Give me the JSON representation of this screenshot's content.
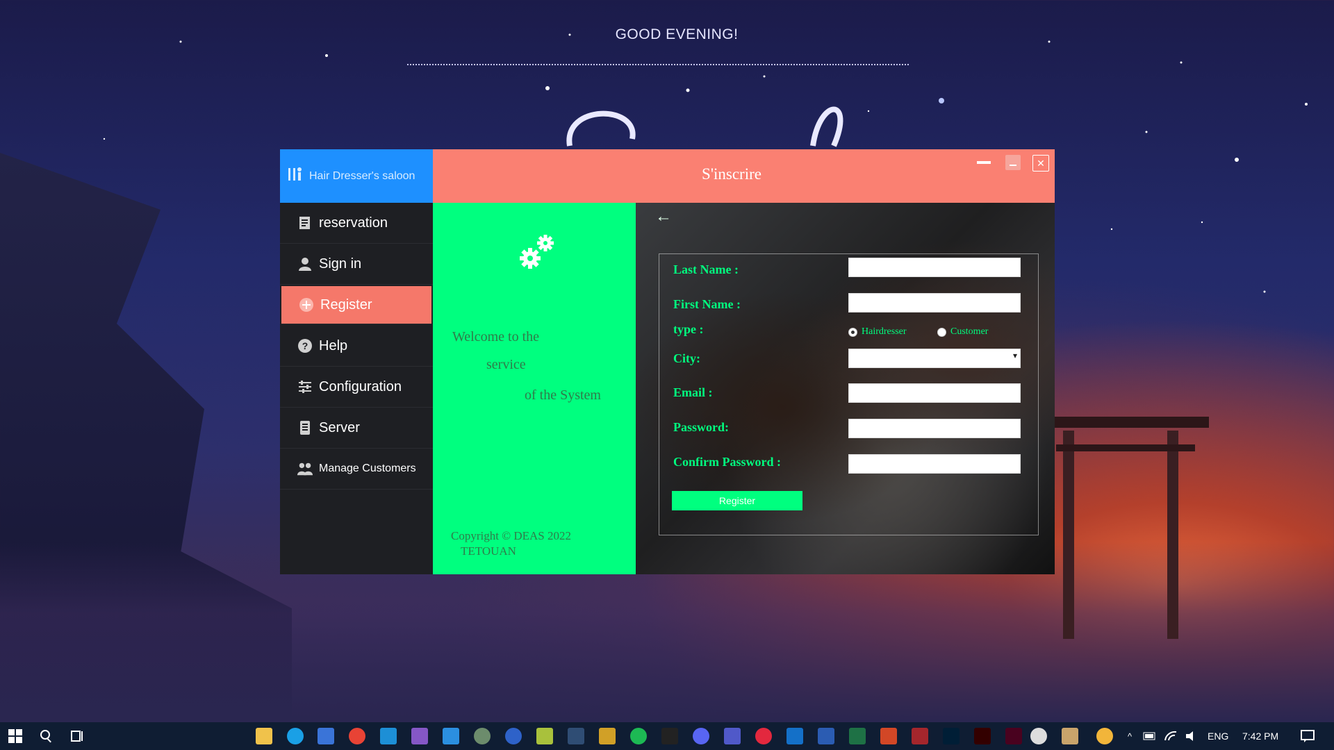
{
  "desktop": {
    "greeting": "GOOD EVENING!"
  },
  "sidebar": {
    "brand": "Hair Dresser's saloon",
    "items": [
      {
        "label": "reservation",
        "icon": "reservation-icon"
      },
      {
        "label": "Sign in",
        "icon": "user-icon"
      },
      {
        "label": "Register",
        "icon": "plus-circle-icon"
      },
      {
        "label": "Help",
        "icon": "help-icon"
      },
      {
        "label": "Configuration",
        "icon": "sliders-icon"
      },
      {
        "label": "Server",
        "icon": "server-icon"
      },
      {
        "label": "Manage Customers",
        "icon": "users-icon"
      }
    ]
  },
  "window": {
    "title": "S'inscrire",
    "accent": "#fa8072",
    "sidebar_accent": "#1e90ff",
    "green": "#00ff7f"
  },
  "welcome": {
    "line1": "Welcome to the",
    "line2": "service",
    "line3": "of the System",
    "copyright1": "Copyright ©   DEAS 2022",
    "copyright2": "TETOUAN"
  },
  "form": {
    "last_name_label": "Last Name :",
    "first_name_label": "First Name :",
    "type_label": "type :",
    "radio_hairdresser": "Hairdresser",
    "radio_customer": "Customer",
    "city_label": "City:",
    "email_label": "Email :",
    "password_label": "Password:",
    "confirm_password_label": "Confirm Password :",
    "register_button": "Register",
    "last_name_value": "",
    "first_name_value": "",
    "city_value": "",
    "email_value": "",
    "password_value": "",
    "confirm_password_value": ""
  },
  "taskbar": {
    "language": "ENG",
    "time": "7:42 PM"
  }
}
